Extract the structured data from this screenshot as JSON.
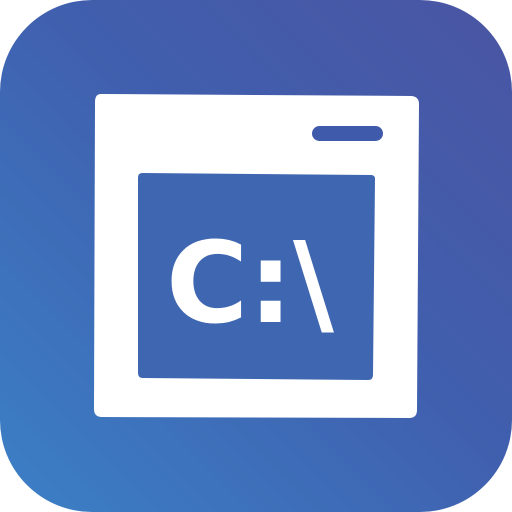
{
  "icon": {
    "name": "command-prompt-icon",
    "prompt_text": "C:\\"
  },
  "colors": {
    "background_top": "#4a55a3",
    "background_bottom": "#3b80c6",
    "window_frame": "#ffffff",
    "screen": "#3f66b0"
  }
}
